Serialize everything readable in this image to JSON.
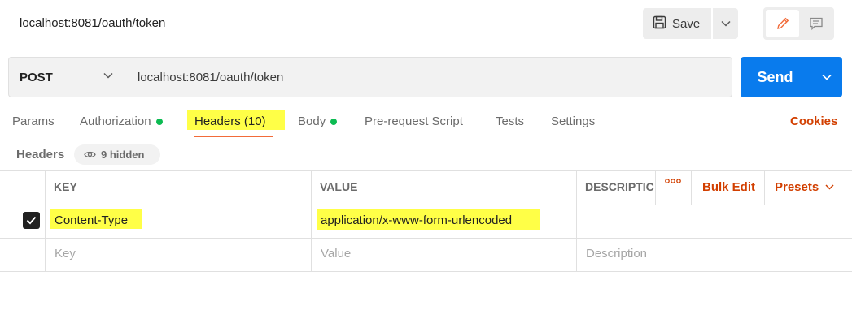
{
  "request": {
    "title": "localhost:8081/oauth/token",
    "save_label": "Save",
    "method": "POST",
    "url": "localhost:8081/oauth/token",
    "send_label": "Send"
  },
  "tabs": [
    {
      "label": "Params",
      "dot": false
    },
    {
      "label": "Authorization",
      "dot": true
    },
    {
      "label": "Headers (10)",
      "dot": false,
      "active": true
    },
    {
      "label": "Body",
      "dot": true
    },
    {
      "label": "Pre-request Script",
      "dot": false
    },
    {
      "label": "Tests",
      "dot": false
    },
    {
      "label": "Settings",
      "dot": false
    }
  ],
  "cookies_label": "Cookies",
  "headers_section": {
    "label": "Headers",
    "hidden_badge": "9 hidden"
  },
  "table": {
    "columns": {
      "key": "KEY",
      "value": "VALUE",
      "description": "DESCRIPTIC"
    },
    "actions": {
      "bulk_edit": "Bulk Edit",
      "presets": "Presets"
    },
    "rows": [
      {
        "checked": true,
        "key": "Content-Type",
        "value": "application/x-www-form-urlencoded",
        "description": ""
      }
    ],
    "placeholders": {
      "key": "Key",
      "value": "Value",
      "description": "Description"
    }
  },
  "colors": {
    "send": "#097bed",
    "accent_orange": "#f26b3a",
    "link_orange": "#d23f00",
    "highlight": "#ffff47",
    "status_green": "#0cbb52"
  }
}
